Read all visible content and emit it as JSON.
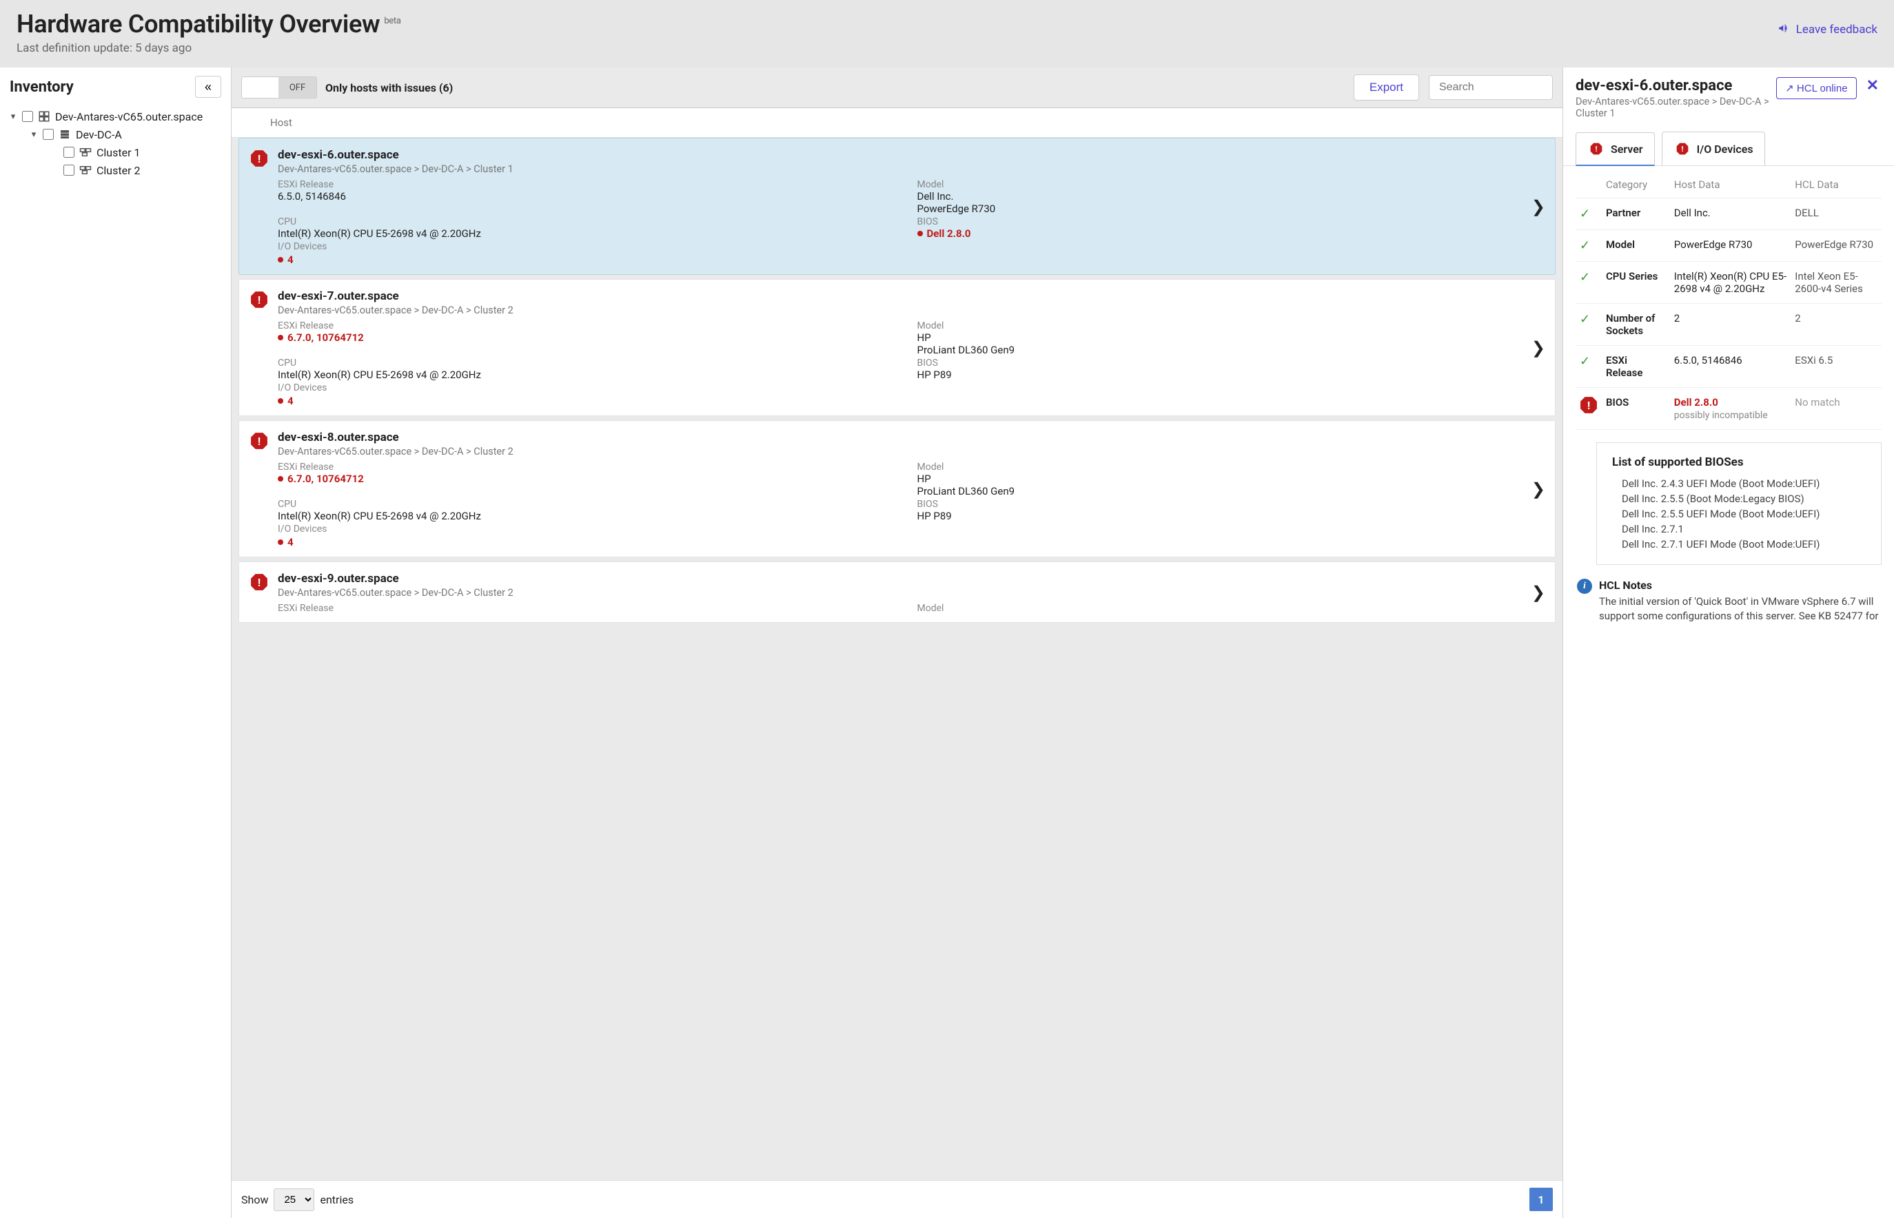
{
  "header": {
    "title": "Hardware Compatibility Overview",
    "badge": "beta",
    "subline": "Last definition update: 5 days ago",
    "feedback_label": "Leave feedback"
  },
  "inventory": {
    "title": "Inventory",
    "collapse_glyph": "«",
    "nodes": {
      "vcenter": "Dev-Antares-vC65.outer.space",
      "datacenter": "Dev-DC-A",
      "cluster1": "Cluster 1",
      "cluster2": "Cluster 2"
    }
  },
  "toolbar": {
    "toggle_off": "OFF",
    "toggle_label": "Only hosts with issues (6)",
    "export_label": "Export",
    "search_placeholder": "Search"
  },
  "host_column": {
    "header": "Host"
  },
  "hosts": [
    {
      "name": "dev-esxi-6.outer.space",
      "breadcrumb": "Dev-Antares-vC65.outer.space > Dev-DC-A > Cluster 1",
      "esxi_label": "ESXi Release",
      "esxi": "6.5.0, 5146846",
      "esxi_bad": false,
      "model_label": "Model",
      "vendor": "Dell Inc.",
      "model": "PowerEdge R730",
      "cpu_label": "CPU",
      "cpu": "Intel(R) Xeon(R) CPU E5-2698 v4 @ 2.20GHz",
      "bios_label": "BIOS",
      "bios": "Dell 2.8.0",
      "bios_bad": true,
      "io_label": "I/O Devices",
      "io": "4",
      "selected": true
    },
    {
      "name": "dev-esxi-7.outer.space",
      "breadcrumb": "Dev-Antares-vC65.outer.space > Dev-DC-A > Cluster 2",
      "esxi_label": "ESXi Release",
      "esxi": "6.7.0, 10764712",
      "esxi_bad": true,
      "model_label": "Model",
      "vendor": "HP",
      "model": "ProLiant DL360 Gen9",
      "cpu_label": "CPU",
      "cpu": "Intel(R) Xeon(R) CPU E5-2698 v4 @ 2.20GHz",
      "bios_label": "BIOS",
      "bios": "HP P89",
      "bios_bad": false,
      "io_label": "I/O Devices",
      "io": "4",
      "selected": false
    },
    {
      "name": "dev-esxi-8.outer.space",
      "breadcrumb": "Dev-Antares-vC65.outer.space > Dev-DC-A > Cluster 2",
      "esxi_label": "ESXi Release",
      "esxi": "6.7.0, 10764712",
      "esxi_bad": true,
      "model_label": "Model",
      "vendor": "HP",
      "model": "ProLiant DL360 Gen9",
      "cpu_label": "CPU",
      "cpu": "Intel(R) Xeon(R) CPU E5-2698 v4 @ 2.20GHz",
      "bios_label": "BIOS",
      "bios": "HP P89",
      "bios_bad": false,
      "io_label": "I/O Devices",
      "io": "4",
      "selected": false
    },
    {
      "name": "dev-esxi-9.outer.space",
      "breadcrumb": "Dev-Antares-vC65.outer.space > Dev-DC-A > Cluster 2",
      "esxi_label": "ESXi Release",
      "esxi": "",
      "esxi_bad": false,
      "model_label": "Model",
      "vendor": "",
      "model": "",
      "cpu_label": "",
      "cpu": "",
      "bios_label": "",
      "bios": "",
      "bios_bad": false,
      "io_label": "",
      "io": "",
      "selected": false,
      "truncated": true
    }
  ],
  "pager": {
    "show": "Show",
    "page_size": "25",
    "entries": "entries",
    "page": "1"
  },
  "details": {
    "title": "dev-esxi-6.outer.space",
    "breadcrumb": "Dev-Antares-vC65.outer.space > Dev-DC-A > Cluster 1",
    "hcl_online": "HCL online",
    "close": "✕",
    "tabs": {
      "server": "Server",
      "io": "I/O Devices"
    },
    "columns": {
      "cat": "Category",
      "host": "Host Data",
      "hcl": "HCL Data"
    },
    "rows": [
      {
        "status": "ok",
        "cat": "Partner",
        "host": "Dell Inc.",
        "hcl": "DELL"
      },
      {
        "status": "ok",
        "cat": "Model",
        "host": "PowerEdge R730",
        "hcl": "PowerEdge R730"
      },
      {
        "status": "ok",
        "cat": "CPU Series",
        "host": "Intel(R) Xeon(R) CPU E5-2698 v4 @ 2.20GHz",
        "hcl": "Intel Xeon E5-2600-v4 Series"
      },
      {
        "status": "ok",
        "cat": "Number of Sockets",
        "host": "2",
        "hcl": "2"
      },
      {
        "status": "ok",
        "cat": "ESXi Release",
        "host": "6.5.0, 5146846",
        "hcl": "ESXi 6.5"
      },
      {
        "status": "bad",
        "cat": "BIOS",
        "host": "Dell 2.8.0",
        "host_sub": "possibly incompatible",
        "hcl": "No match"
      }
    ],
    "bios_box": {
      "title": "List of supported BIOSes",
      "items": [
        "Dell Inc. 2.4.3 UEFI Mode (Boot Mode:UEFI)",
        "Dell Inc. 2.5.5 (Boot Mode:Legacy BIOS)",
        "Dell Inc. 2.5.5 UEFI Mode (Boot Mode:UEFI)",
        "Dell Inc. 2.7.1",
        "Dell Inc. 2.7.1 UEFI Mode (Boot Mode:UEFI)"
      ]
    },
    "hcl_notes": {
      "title": "HCL Notes",
      "body": "The initial version of 'Quick Boot' in VMware vSphere 6.7 will support some configurations of this server. See KB 52477 for"
    }
  }
}
